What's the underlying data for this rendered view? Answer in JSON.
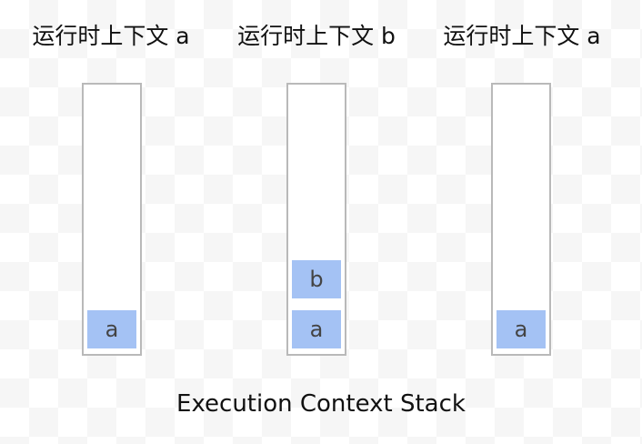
{
  "columns": [
    {
      "title": "运行时上下文 a",
      "frames": [
        "a"
      ]
    },
    {
      "title": "运行时上下文 b",
      "frames": [
        "a",
        "b"
      ]
    },
    {
      "title": "运行时上下文 a",
      "frames": [
        "a"
      ]
    }
  ],
  "footer": {
    "title": "Execution Context Stack"
  },
  "colors": {
    "frame_fill": "#a4c2f4",
    "stack_border": "#b9b9b9"
  }
}
